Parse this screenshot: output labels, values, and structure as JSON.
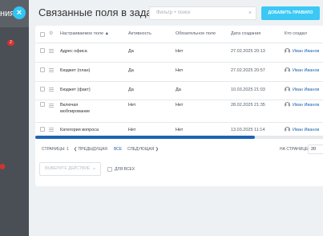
{
  "background": {
    "title_fragment": "ния",
    "badge_text": "2"
  },
  "panel": {
    "title": "Связанные поля в задачах",
    "filter_placeholder": "Фильтр + поиск",
    "add_button": "ДОБАВИТЬ ПРАВИЛО"
  },
  "table": {
    "columns": [
      "Настраиваемое поле",
      "Активность",
      "Обязательное поле",
      "Дата создания",
      "Кто создал"
    ],
    "rows": [
      {
        "field": "Адрес офиса",
        "active": "Да",
        "required": "Нет",
        "date": "27.02.2025 20:13",
        "author": "Иван Иванов"
      },
      {
        "field": "Бюджет (план)",
        "active": "Да",
        "required": "Нет",
        "date": "27.02.2025 20:57",
        "author": "Иван Иванов"
      },
      {
        "field": "Бюджет (факт)",
        "active": "Да",
        "required": "Да",
        "date": "10.03.2025 21:03",
        "author": "Иван Иванов"
      },
      {
        "field": "Включая",
        "field_line2": "моблирование",
        "active": "Нет",
        "required": "Нет",
        "date": "28.02.2025 21:35",
        "author": "Иван Иванов"
      },
      {
        "field": "Категория вопроса",
        "active": "Нет",
        "required": "Нет",
        "date": "13.03.2025 11:14",
        "author": "Иван Иванов"
      }
    ]
  },
  "pager": {
    "pages_label": "СТРАНИЦЫ: 1",
    "prev": "ПРЕДЫДУЩАЯ",
    "all": "ВСЕ",
    "next": "СЛЕДУЮЩАЯ",
    "per_page_label": "НА СТРАНИЦЕ:",
    "per_page_value": "20"
  },
  "actions": {
    "select_placeholder": "ВЫБЕРИТЕ ДЕЙСТВИЕ",
    "for_all_label": "ДЛЯ ВСЕХ"
  },
  "icons": {
    "close": "close-icon",
    "gear": "gear-icon",
    "row_menu": "menu-icon",
    "avatar": "user-avatar-icon"
  },
  "colors": {
    "accent": "#3bc8f5",
    "link": "#2067b0",
    "scrollbar": "#1e64b4"
  }
}
